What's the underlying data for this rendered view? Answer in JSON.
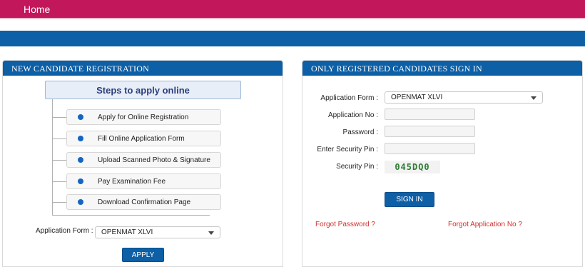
{
  "nav": {
    "home": "Home"
  },
  "left": {
    "title": "NEW CANDIDATE REGISTRATION",
    "steps_title": "Steps to apply online",
    "steps": [
      "Apply for Online Registration",
      "Fill Online Application Form",
      "Upload Scanned Photo & Signature",
      "Pay Examination Fee",
      "Download Confirmation Page"
    ],
    "app_form_label": "Application Form :",
    "app_form_value": "OPENMAT XLVI",
    "apply_button": "APPLY"
  },
  "right": {
    "title": "ONLY REGISTERED CANDIDATES SIGN IN",
    "app_form_label": "Application Form :",
    "app_form_value": "OPENMAT XLVI",
    "app_no_label": "Application No :",
    "password_label": "Password :",
    "security_pin_entry_label": "Enter Security Pin :",
    "security_pin_label": "Security Pin :",
    "captcha_text": "045DQ0",
    "signin_button": "SIGN IN",
    "forgot_password": "Forgot Password ?",
    "forgot_app_no": "Forgot Application No ?"
  },
  "colors": {
    "topbar": "#c2185b",
    "primary": "#0d5fa6",
    "link": "#d32f2f"
  }
}
